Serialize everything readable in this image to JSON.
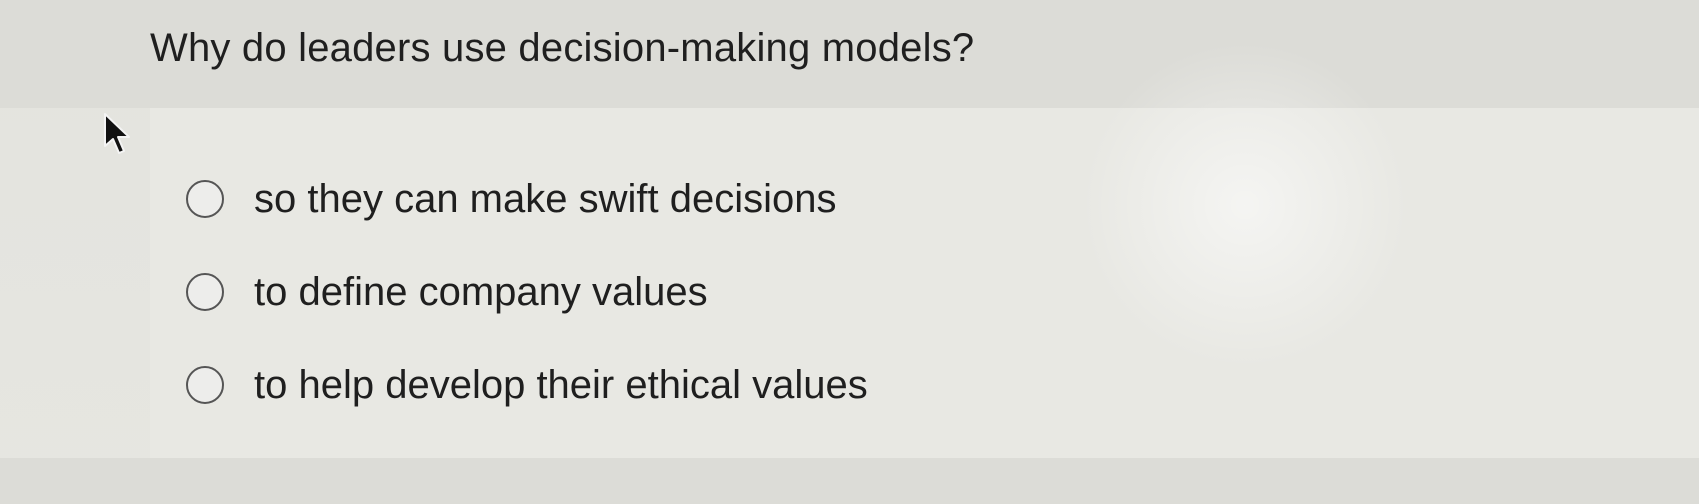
{
  "question": {
    "text": "Why do leaders use decision-making models?"
  },
  "options": [
    {
      "label": "so they can make swift decisions",
      "selected": false
    },
    {
      "label": "to define company values",
      "selected": false
    },
    {
      "label": "to help develop their ethical values",
      "selected": false
    }
  ],
  "cursor": {
    "icon": "arrow-pointer-icon"
  },
  "colors": {
    "background": "#e6e6e1",
    "text": "#1f1f1f",
    "radio_border": "#555555"
  }
}
